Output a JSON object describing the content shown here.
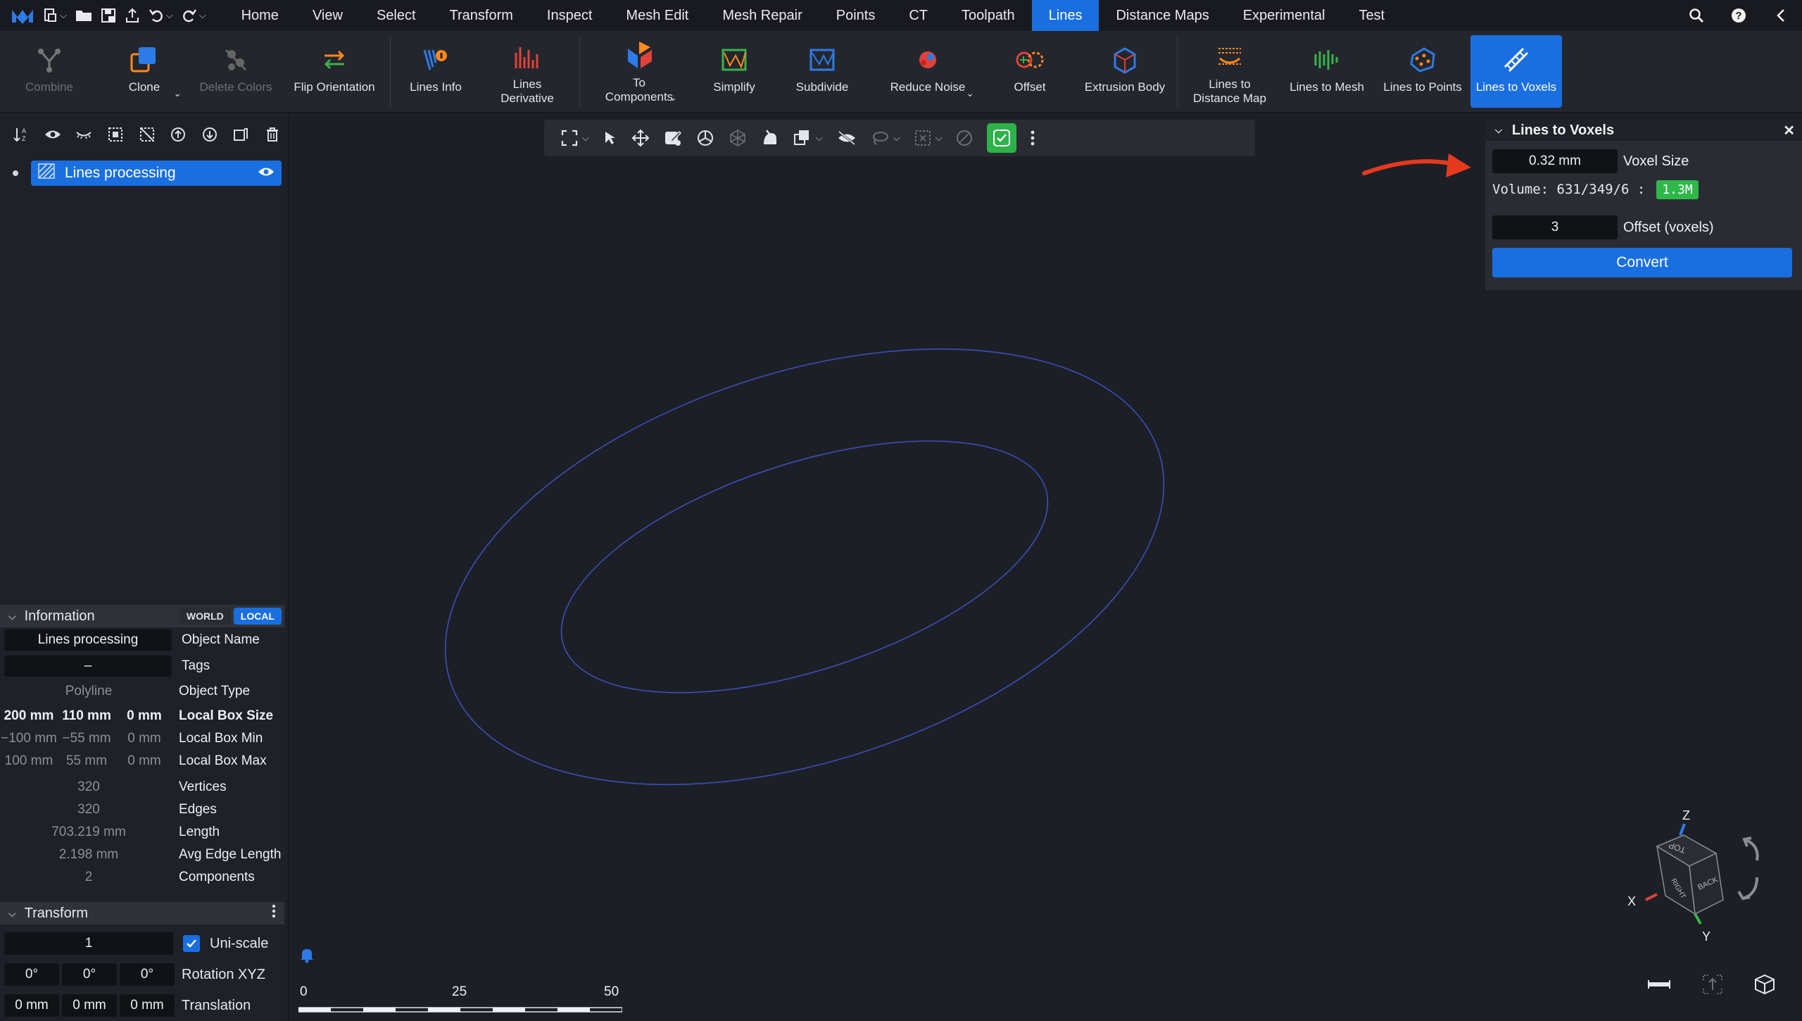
{
  "menu": {
    "tabs": [
      "Home",
      "View",
      "Select",
      "Transform",
      "Inspect",
      "Mesh Edit",
      "Mesh Repair",
      "Points",
      "CT",
      "Toolpath",
      "Lines",
      "Distance Maps",
      "Experimental",
      "Test"
    ],
    "active_tab": "Lines"
  },
  "ribbon": {
    "combine": "Combine",
    "clone": "Clone",
    "delete_colors": "Delete Colors",
    "flip_orientation": "Flip Orientation",
    "lines_info": "Lines Info",
    "lines_derivative_1": "Lines",
    "lines_derivative_2": "Derivative",
    "to_components_1": "To",
    "to_components_2": "Components",
    "simplify": "Simplify",
    "subdivide": "Subdivide",
    "reduce_noise": "Reduce Noise",
    "offset": "Offset",
    "extrusion_body": "Extrusion Body",
    "lines_to_distance_map_1": "Lines to",
    "lines_to_distance_map_2": "Distance Map",
    "lines_to_mesh": "Lines to Mesh",
    "lines_to_points": "Lines to Points",
    "lines_to_voxels": "Lines to Voxels"
  },
  "scene_tree": {
    "item_label": "Lines processing"
  },
  "information": {
    "title": "Information",
    "world": "WORLD",
    "local": "LOCAL",
    "object_name_value": "Lines processing",
    "object_name_key": "Object Name",
    "tags_value": "–",
    "tags_key": "Tags",
    "object_type_value": "Polyline",
    "object_type_key": "Object Type",
    "box_size": [
      "200 mm",
      "110 mm",
      "0 mm"
    ],
    "box_size_key": "Local Box Size",
    "box_min": [
      "−100 mm",
      "−55 mm",
      "0 mm"
    ],
    "box_min_key": "Local Box Min",
    "box_max": [
      "100 mm",
      "55 mm",
      "0 mm"
    ],
    "box_max_key": "Local Box Max",
    "vertices_value": "320",
    "vertices_key": "Vertices",
    "edges_value": "320",
    "edges_key": "Edges",
    "length_value": "703.219 mm",
    "length_key": "Length",
    "avg_edge_value": "2.198 mm",
    "avg_edge_key": "Avg Edge Length",
    "components_value": "2",
    "components_key": "Components"
  },
  "transform": {
    "title": "Transform",
    "scale_value": "1",
    "uniscale_label": "Uni-scale",
    "uniscale_checked": true,
    "rotation": [
      "0°",
      "0°",
      "0°"
    ],
    "rotation_key": "Rotation XYZ",
    "translation": [
      "0 mm",
      "0 mm",
      "0 mm"
    ],
    "translation_key": "Translation"
  },
  "lines_to_voxels": {
    "title": "Lines to Voxels",
    "voxel_size_value": "0.32 mm",
    "voxel_size_label": "Voxel Size",
    "volume_text": "Volume: 631/349/6 :",
    "volume_badge": "1.3M",
    "offset_value": "3",
    "offset_label": "Offset (voxels)",
    "convert_label": "Convert"
  },
  "scale_bar": {
    "labels": [
      "0",
      "25",
      "50"
    ]
  },
  "nav_cube": {
    "axis_x": "X",
    "axis_y": "Y",
    "axis_z": "Z",
    "face_top": "TOP",
    "face_back": "BACK",
    "face_right": "RIGHT"
  },
  "colors": {
    "accent": "#1a6fe0",
    "success": "#2fb84a",
    "curve": "#3a4fb8",
    "arrow": "#e53a1e"
  }
}
